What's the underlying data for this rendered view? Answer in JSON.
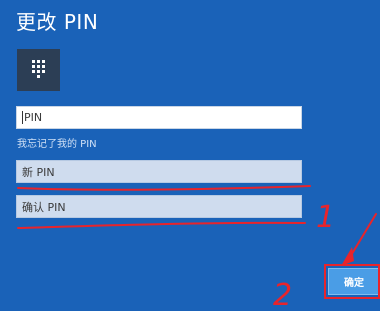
{
  "dialog": {
    "title": "更改 PIN",
    "forgot_link": "我忘记了我的 PIN",
    "confirm_button": "确定"
  },
  "fields": {
    "current_pin_value": "PIN",
    "new_pin_placeholder": "新 PIN",
    "confirm_pin_placeholder": "确认 PIN"
  },
  "icons": {
    "keypad": "keypad-icon"
  },
  "annotations": {
    "mark_1": "1",
    "mark_2": "2"
  },
  "colors": {
    "background": "#1a62b8",
    "annotation": "#e8242b",
    "button": "#4a9de6"
  }
}
